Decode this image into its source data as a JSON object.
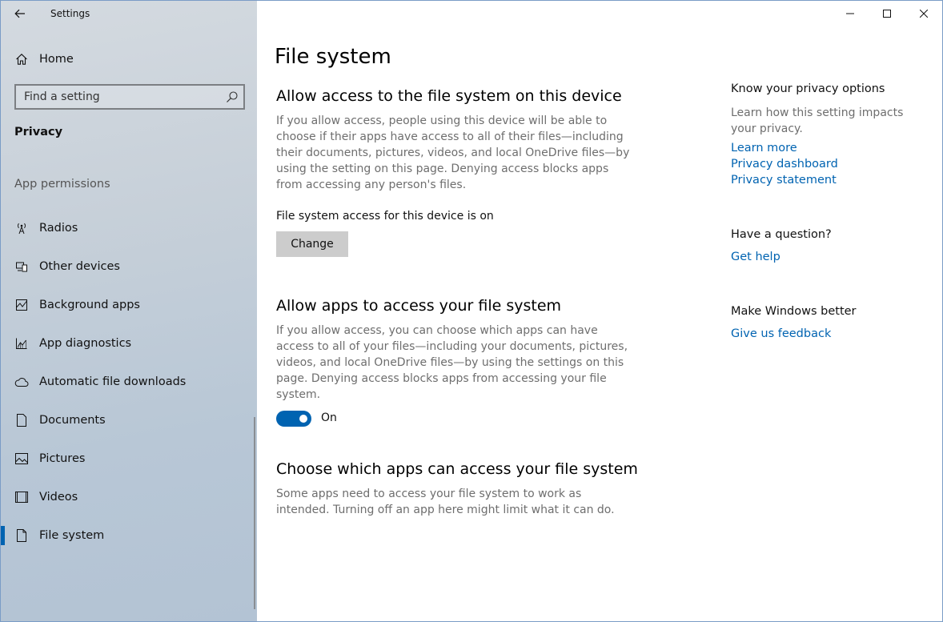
{
  "window": {
    "title": "Settings"
  },
  "sidebar": {
    "home_label": "Home",
    "search_placeholder": "Find a setting",
    "section": "Privacy",
    "group_header": "App permissions",
    "items": [
      {
        "label": "Radios",
        "icon": "radio-tower-icon"
      },
      {
        "label": "Other devices",
        "icon": "devices-icon"
      },
      {
        "label": "Background apps",
        "icon": "background-apps-icon"
      },
      {
        "label": "App diagnostics",
        "icon": "diagnostics-chart-icon"
      },
      {
        "label": "Automatic file downloads",
        "icon": "cloud-icon"
      },
      {
        "label": "Documents",
        "icon": "document-icon"
      },
      {
        "label": "Pictures",
        "icon": "picture-icon"
      },
      {
        "label": "Videos",
        "icon": "video-icon"
      },
      {
        "label": "File system",
        "icon": "file-system-icon",
        "selected": true
      }
    ]
  },
  "main": {
    "page_title": "File system",
    "section1": {
      "heading": "Allow access to the file system on this device",
      "description": "If you allow access, people using this device will be able to choose if their apps have access to all of their files—including their documents, pictures, videos, and local OneDrive files—by using the setting on this page. Denying access blocks apps from accessing any person's files.",
      "status": "File system access for this device is on",
      "button_label": "Change"
    },
    "section2": {
      "heading": "Allow apps to access your file system",
      "description": "If you allow access, you can choose which apps can have access to all of your files—including your documents, pictures, videos, and local OneDrive files—by using the settings on this page. Denying access blocks apps from accessing your file system.",
      "toggle_state": "On"
    },
    "section3": {
      "heading": "Choose which apps can access your file system",
      "description": "Some apps need to access your file system to work as intended. Turning off an app here might limit what it can do."
    }
  },
  "right_panel": {
    "privacy_heading": "Know your privacy options",
    "privacy_desc": "Learn how this setting impacts your privacy.",
    "links": [
      "Learn more",
      "Privacy dashboard",
      "Privacy statement"
    ],
    "question_heading": "Have a question?",
    "help_link": "Get help",
    "better_heading": "Make Windows better",
    "feedback_link": "Give us feedback"
  },
  "colors": {
    "accent": "#0063b1",
    "description_text": "#6e6e6e"
  }
}
